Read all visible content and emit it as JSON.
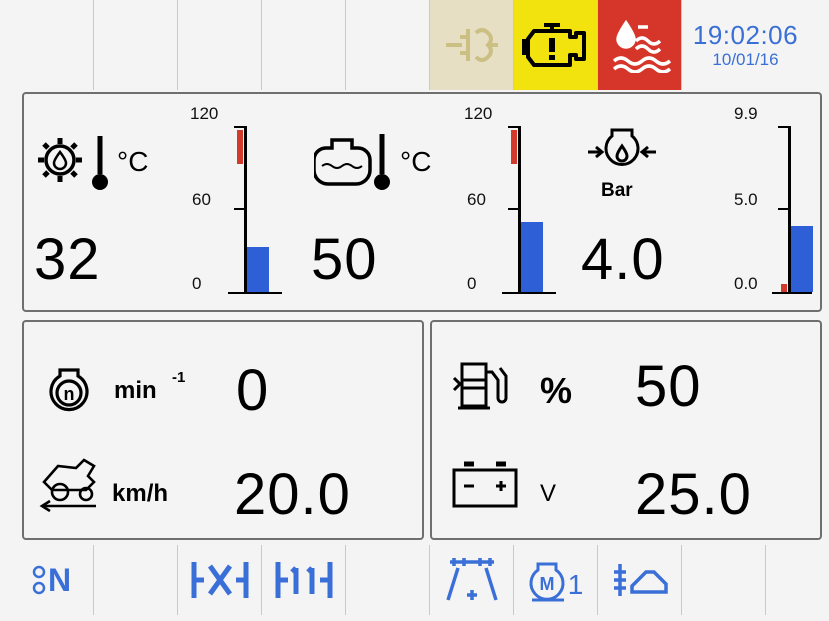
{
  "header": {
    "time": "19:02:06",
    "date": "10/01/16"
  },
  "gauges": [
    {
      "icon": "transmission-oil-temperature-icon",
      "unit": "°C",
      "value": "32",
      "scale": {
        "max": "120",
        "mid": "60",
        "min": "0"
      },
      "level_percent": 27
    },
    {
      "icon": "engine-coolant-temperature-icon",
      "unit": "°C",
      "value": "50",
      "scale": {
        "max": "120",
        "mid": "60",
        "min": "0"
      },
      "level_percent": 42
    },
    {
      "icon": "oil-pressure-icon",
      "unit": "Bar",
      "value": "4.0",
      "scale": {
        "max": "9.9",
        "mid": "5.0",
        "min": "0.0"
      },
      "level_percent": 40
    }
  ],
  "readouts": {
    "engine_speed": {
      "unit": "min",
      "unit_sup": "-1",
      "value": "0"
    },
    "ground_speed": {
      "unit": "km/h",
      "value": "20.0"
    },
    "fuel_level": {
      "unit": "%",
      "value": "50"
    },
    "battery_voltage": {
      "unit": "V",
      "value": "25.0"
    }
  },
  "bottom_bar": {
    "neutral_label": "N",
    "mode_label": "1"
  },
  "colors": {
    "accent_blue": "#2f5fd6",
    "warning_yellow": "#f2e20d",
    "alarm_red": "#d6362a",
    "clock_blue": "#3a6fd6"
  }
}
